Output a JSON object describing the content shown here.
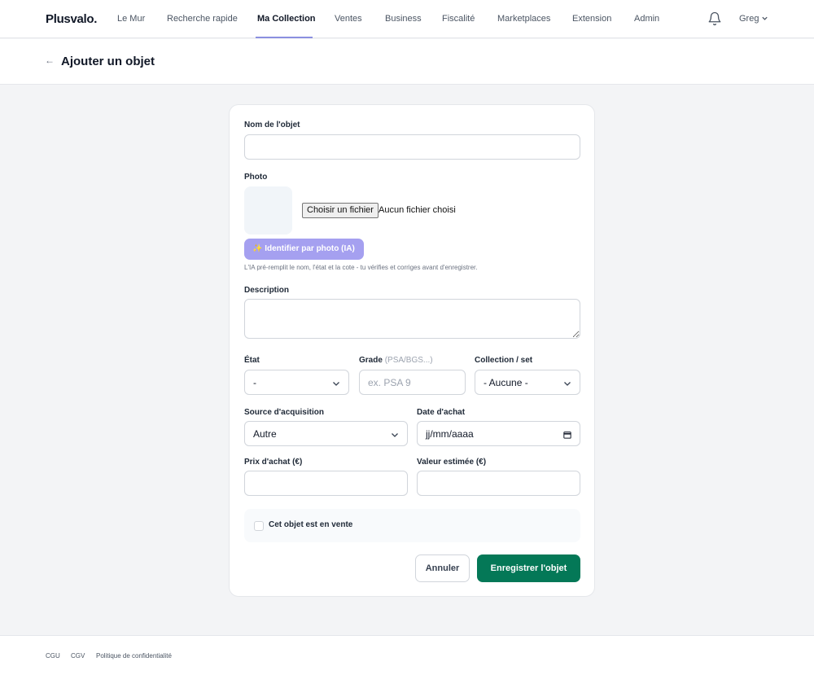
{
  "brand": "Plusvalo.",
  "nav": {
    "items": [
      {
        "label": "Le Mur"
      },
      {
        "label": "Recherche rapide"
      },
      {
        "label": "Ma Collection"
      },
      {
        "label": "Ventes"
      },
      {
        "label": "Business"
      },
      {
        "label": "Fiscalité"
      },
      {
        "label": "Marketplaces"
      },
      {
        "label": "Extension"
      },
      {
        "label": "Admin"
      }
    ],
    "active": "Ma Collection",
    "user": "Greg"
  },
  "header": {
    "back": "←",
    "title": "Ajouter un objet"
  },
  "form": {
    "name": {
      "label": "Nom de l'objet",
      "value": ""
    },
    "photo": {
      "label": "Photo",
      "file_button": "Choisir un fichier",
      "file_status": "Aucun fichier choisi",
      "ai_button": "✨ Identifier par photo (IA)",
      "ai_hint": "L'IA pré-remplit le nom, l'état et la cote - tu vérifies et corriges avant d'enregistrer."
    },
    "description": {
      "label": "Description",
      "value": ""
    },
    "state": {
      "label": "État",
      "value": "-"
    },
    "grade": {
      "label": "Grade",
      "label_hint": "(PSA/BGS...)",
      "placeholder": "ex. PSA 9"
    },
    "collection": {
      "label": "Collection / set",
      "value": "- Aucune -"
    },
    "source": {
      "label": "Source d'acquisition",
      "value": "Autre"
    },
    "purchase_date": {
      "label": "Date d'achat",
      "placeholder": "jj/mm/aaaa"
    },
    "purchase_price": {
      "label": "Prix d'achat (€)",
      "value": ""
    },
    "estimated_value": {
      "label": "Valeur estimée (€)",
      "value": ""
    },
    "for_sale": {
      "label": "Cet objet est en vente",
      "checked": false
    },
    "cancel": "Annuler",
    "save": "Enregistrer l'objet"
  },
  "footer": {
    "links": [
      "CGU",
      "CGV",
      "Politique de confidentialité"
    ]
  },
  "colors": {
    "primary": "#047857",
    "ai": "#a5a0f0",
    "nav_active": "#8b8fe0"
  }
}
